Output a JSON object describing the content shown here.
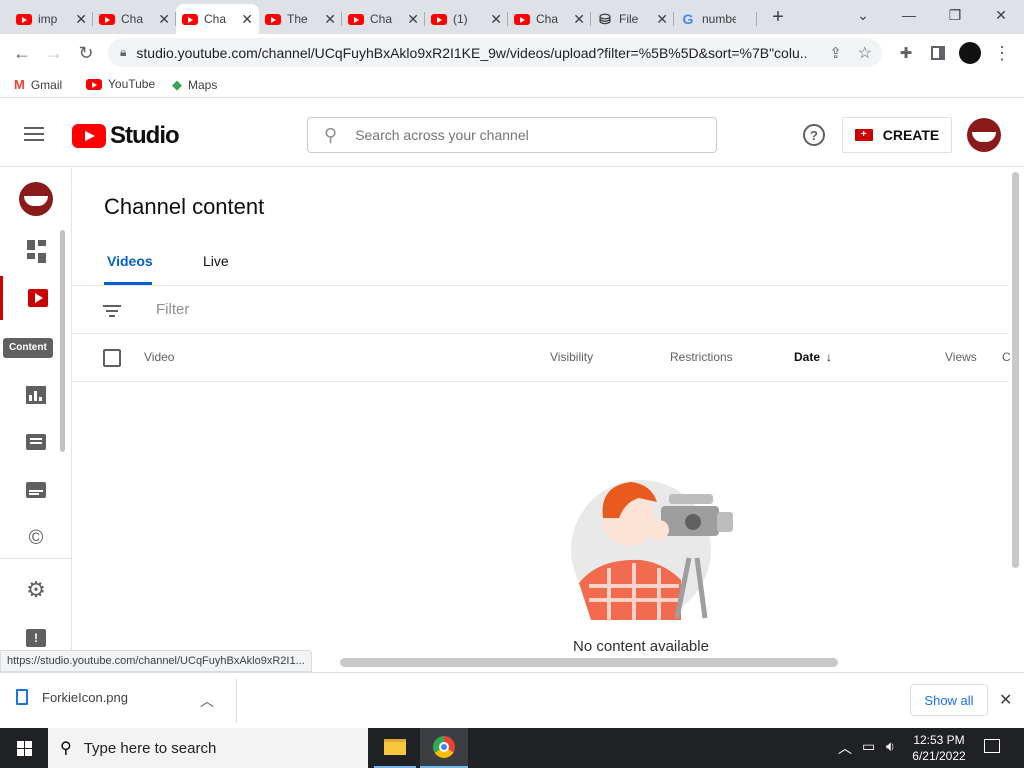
{
  "browser": {
    "tabs": [
      {
        "title": "imp",
        "icon": "youtube-icon",
        "active": false
      },
      {
        "title": "Cha",
        "icon": "youtube-icon",
        "active": false
      },
      {
        "title": "Cha",
        "icon": "youtube-icon",
        "active": true
      },
      {
        "title": "The",
        "icon": "youtube-icon",
        "active": false
      },
      {
        "title": "Cha",
        "icon": "youtube-icon",
        "active": false
      },
      {
        "title": "(1)",
        "icon": "youtube-icon",
        "active": false
      },
      {
        "title": "Cha",
        "icon": "youtube-icon",
        "active": false
      },
      {
        "title": "File",
        "icon": "file-icon",
        "active": false
      },
      {
        "title": "number",
        "icon": "google-icon",
        "active": false
      }
    ],
    "new_tab": "+",
    "url": "studio.youtube.com/channel/UCqFuyhBxAklo9xR2I1KE_9w/videos/upload?filter=%5B%5D&sort=%7B\"colu...",
    "bookmarks": [
      {
        "label": "Gmail",
        "icon": "gmail-icon"
      },
      {
        "label": "YouTube",
        "icon": "youtube-icon"
      },
      {
        "label": "Maps",
        "icon": "maps-icon"
      }
    ],
    "status_url": "https://studio.youtube.com/channel/UCqFuyhBxAklo9xR2I1..."
  },
  "studio": {
    "logo_text": "Studio",
    "search_placeholder": "Search across your channel",
    "create_label": "CREATE",
    "page_title": "Channel content",
    "tabs": [
      "Videos",
      "Live"
    ],
    "active_tab": "Videos",
    "filter_placeholder": "Filter",
    "columns": {
      "video": "Video",
      "visibility": "Visibility",
      "restrictions": "Restrictions",
      "date": "Date",
      "views": "Views",
      "comments": "C"
    },
    "empty_message": "No content available",
    "sidebar_tooltip": "Content",
    "sidebar_items": [
      "dashboard-icon",
      "content-icon",
      "analytics-icon",
      "comments-icon",
      "subtitles-icon",
      "copyright-icon",
      "settings-icon",
      "feedback-icon"
    ]
  },
  "downloads": {
    "file_name": "ForkieIcon.png",
    "show_all": "Show all"
  },
  "taskbar": {
    "search_placeholder": "Type here to search",
    "time": "12:53 PM",
    "date": "6/21/2022"
  },
  "colors": {
    "accent_blue": "#065fd4",
    "brand_red": "#ff0000",
    "tab_strip": "#dee1e6",
    "taskbar": "#202124"
  }
}
